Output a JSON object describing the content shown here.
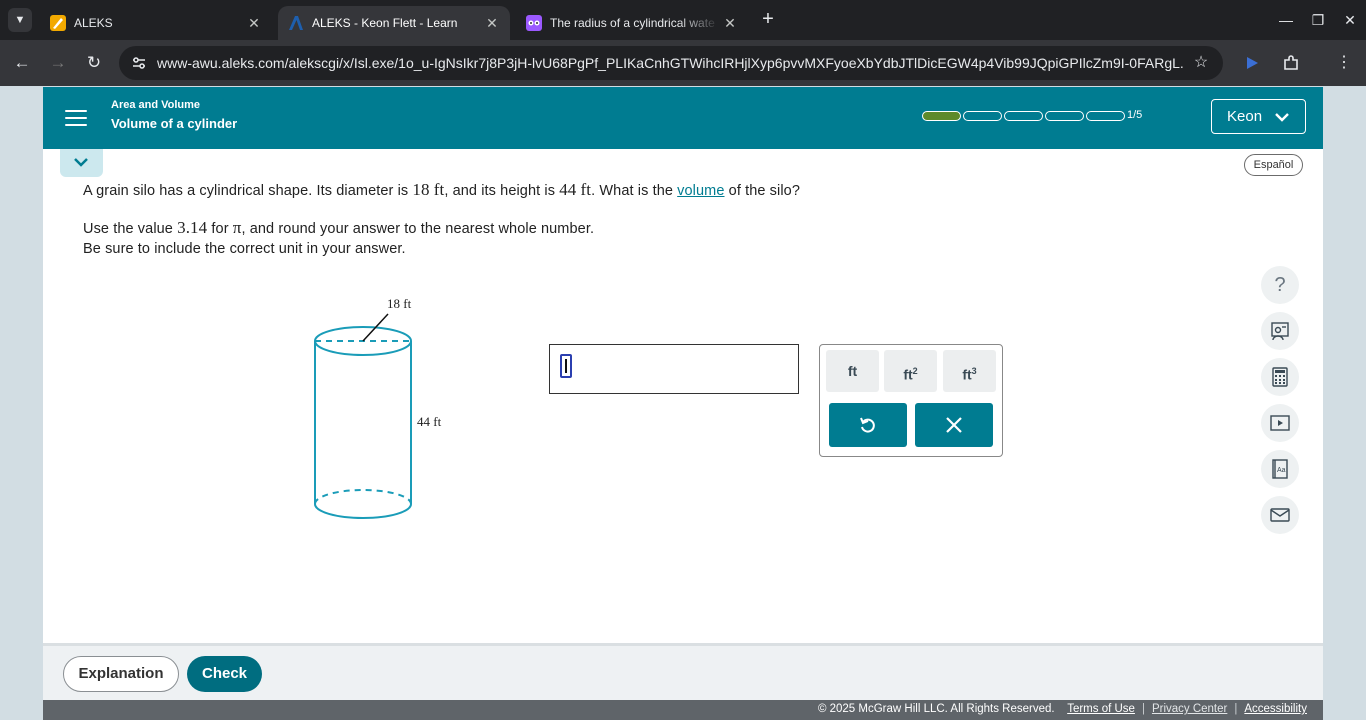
{
  "browser": {
    "tabs": [
      {
        "title": "ALEKS",
        "favicon": "aleks-pencil-icon",
        "active": false
      },
      {
        "title": "ALEKS - Keon Flett - Learn",
        "favicon": "aleks-a-icon",
        "active": true
      },
      {
        "title": "The radius of a cylindrical wate",
        "favicon": "owl-icon",
        "active": false
      }
    ],
    "url": "www-awu.aleks.com/alekscgi/x/Isl.exe/1o_u-IgNsIkr7j8P3jH-lvU68PgPf_PLIKaCnhGTWihcIRHjlXyp6pvvMXFyoeXbYdbJTlDicEGW4p4Vib99JQpiGPIlcZm9I-0FARgL..."
  },
  "header": {
    "topic": "Area and Volume",
    "subtopic": "Volume of a cylinder",
    "progress_label": "1/5",
    "progress_completed": 1,
    "progress_total": 5,
    "user_name": "Keon"
  },
  "language_button": "Español",
  "question": {
    "line1_a": "A grain silo has a cylindrical shape. Its diameter is",
    "diameter": "18",
    "unit_a": "ft",
    "line1_b": ", and its height is",
    "height": "44",
    "unit_b": "ft",
    "line1_c": ". What is the",
    "link": "volume",
    "line1_d": "of the silo?",
    "line2_a": "Use the value",
    "pi_value": "3.14",
    "line2_b": "for",
    "pi": "π",
    "line2_c": ", and round your answer to the nearest whole number.",
    "line3": "Be sure to include the correct unit in your answer."
  },
  "figure": {
    "diameter_label": "18 ft",
    "height_label": "44 ft"
  },
  "answer": {
    "value": ""
  },
  "units": {
    "ft": "ft",
    "ft2_base": "ft",
    "ft2_exp": "2",
    "ft3_base": "ft",
    "ft3_exp": "3"
  },
  "footer": {
    "explanation": "Explanation",
    "check": "Check",
    "copyright": "© 2025 McGraw Hill LLC. All Rights Reserved.",
    "terms": "Terms of Use",
    "privacy": "Privacy Center",
    "accessibility": "Accessibility"
  },
  "colors": {
    "brand_teal": "#007c91",
    "progress_done": "#5d8a2a",
    "figure_stroke": "#1a9cb8"
  }
}
